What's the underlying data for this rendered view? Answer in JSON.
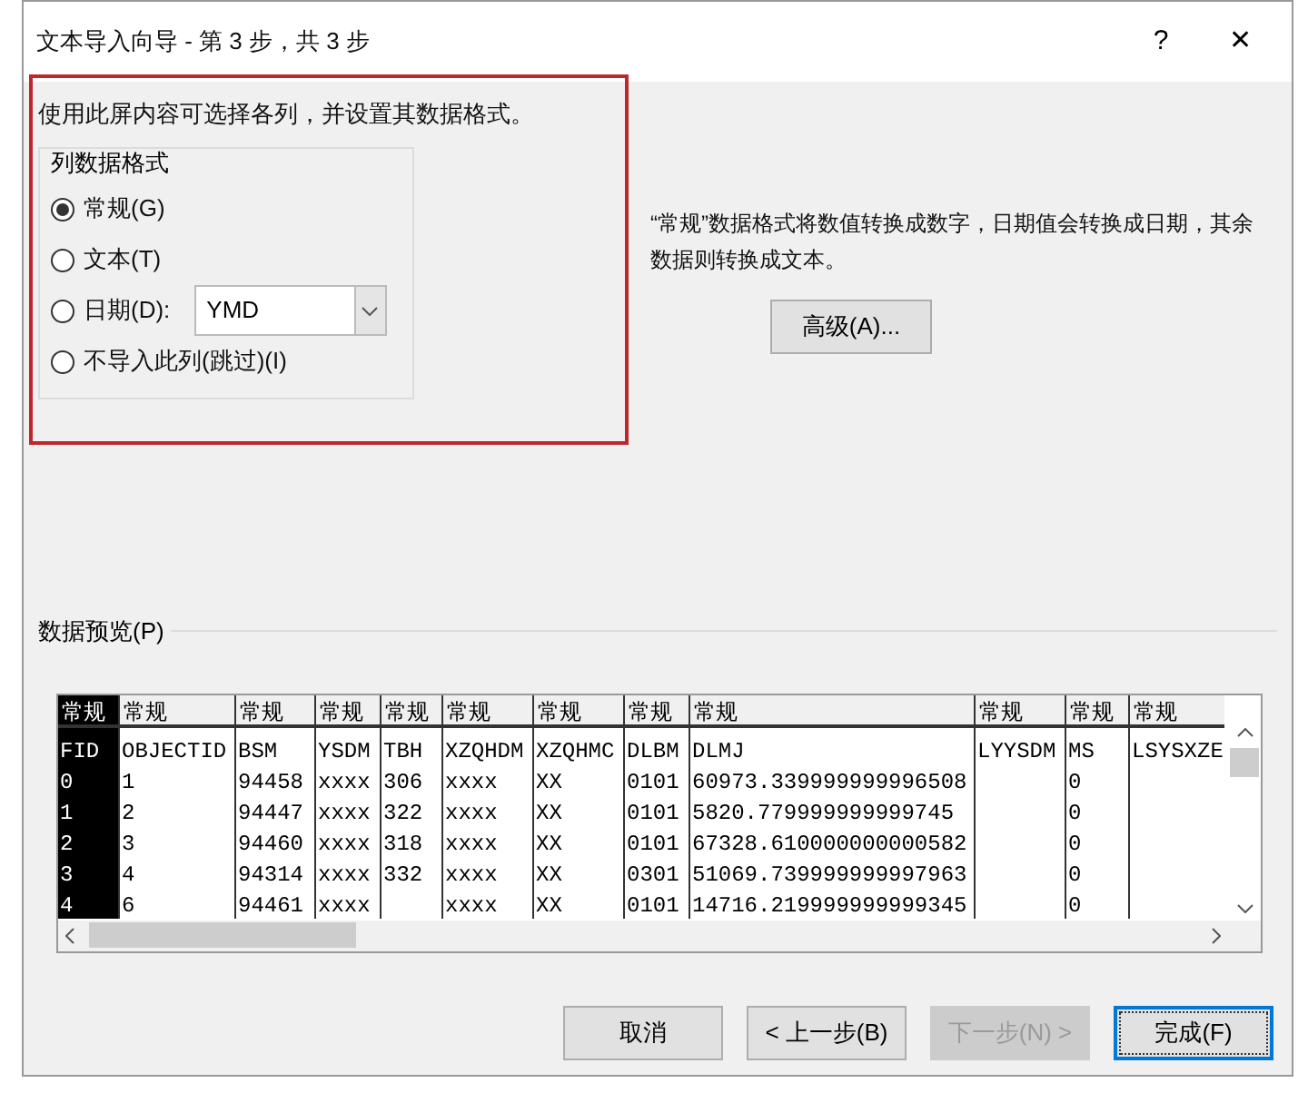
{
  "window": {
    "title": "文本导入向导 - 第 3 步，共 3 步",
    "help": "?",
    "close": "✕"
  },
  "intro": "使用此屏内容可选择各列，并设置其数据格式。",
  "format_group": {
    "label": "列数据格式",
    "options": [
      {
        "label": "常规(G)",
        "selected": true
      },
      {
        "label": "文本(T)",
        "selected": false
      },
      {
        "label": "日期(D):",
        "selected": false,
        "date_value": "YMD"
      },
      {
        "label": "不导入此列(跳过)(I)",
        "selected": false
      }
    ]
  },
  "description": "“常规”数据格式将数值转换成数字，日期值会转换成日期，其余数据则转换成文本。",
  "advanced_button": "高级(A)...",
  "preview": {
    "label": "数据预览(P)",
    "columns": [
      {
        "format": "常规",
        "selected": true
      },
      {
        "format": "常规",
        "selected": false
      },
      {
        "format": "常规",
        "selected": false
      },
      {
        "format": "常规",
        "selected": false
      },
      {
        "format": "常规",
        "selected": false
      },
      {
        "format": "常规",
        "selected": false
      },
      {
        "format": "常规",
        "selected": false
      },
      {
        "format": "常规",
        "selected": false
      },
      {
        "format": "常规",
        "selected": false
      },
      {
        "format": "常规",
        "selected": false
      },
      {
        "format": "常规",
        "selected": false
      },
      {
        "format": "常规",
        "selected": false
      }
    ],
    "rows": [
      [
        "FID",
        "OBJECTID",
        "BSM",
        "YSDM",
        "TBH",
        "XZQHDM",
        "XZQHMC",
        "DLBM",
        "DLMJ",
        "LYYSDM",
        "MS",
        "LSYSXZE"
      ],
      [
        "0",
        "1",
        "94458",
        "xxxx",
        "306",
        "xxxx",
        "XX",
        "0101",
        "60973.339999999996508",
        null,
        "0",
        null
      ],
      [
        "1",
        "2",
        "94447",
        "xxxx",
        "322",
        "xxxx",
        "XX",
        "0101",
        "5820.779999999999745",
        null,
        "0",
        null
      ],
      [
        "2",
        "3",
        "94460",
        "xxxx",
        "318",
        "xxxx",
        "XX",
        "0101",
        "67328.610000000000582",
        null,
        "0",
        null
      ],
      [
        "3",
        "4",
        "94314",
        "xxxx",
        "332",
        "xxxx",
        "XX",
        "0301",
        "51069.739999999997963",
        null,
        "0",
        null
      ],
      [
        "4",
        "6",
        "94461",
        "xxxx",
        null,
        "xxxx",
        "XX",
        "0101",
        "14716.219999999999345",
        null,
        "0",
        null
      ]
    ]
  },
  "buttons": [
    {
      "label": "取消",
      "disabled": false,
      "focused": false
    },
    {
      "label": "< 上一步(B)",
      "disabled": false,
      "focused": false
    },
    {
      "label": "下一步(N) >",
      "disabled": true,
      "focused": false
    },
    {
      "label": "完成(F)",
      "disabled": false,
      "focused": true
    }
  ]
}
